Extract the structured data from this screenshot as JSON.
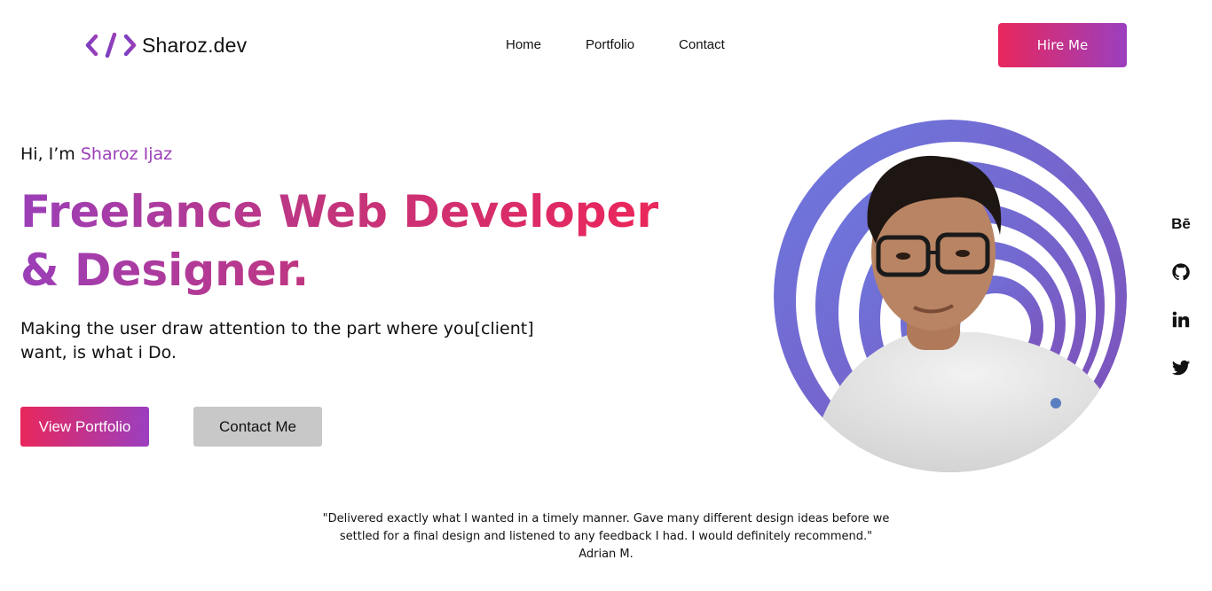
{
  "header": {
    "logo_text": "Sharoz.dev",
    "nav": [
      "Home",
      "Portfolio",
      "Contact"
    ],
    "hire_label": "Hire Me"
  },
  "hero": {
    "greeting_prefix": "Hi, I’m",
    "greeting_name": "Sharoz Ijaz",
    "headline_line1": "Freelance Web Developer",
    "headline_line2": "& Designer.",
    "tagline": "Making the user draw attention to the part where you[client] want, is what i Do.",
    "primary_button": "View Portfolio",
    "secondary_button": "Contact Me",
    "image_alt_icon": "profile-photo"
  },
  "socials": {
    "behance_label": "Bē",
    "icons": [
      "behance-icon",
      "github-icon",
      "linkedin-icon",
      "twitter-icon"
    ]
  },
  "testimonial": {
    "quote": "\"Delivered exactly what I wanted in a timely manner. Gave many different design ideas before we settled for a final design and listened to any feedback I had. I would definitely recommend.\"",
    "author": "Adrian M."
  },
  "colors": {
    "accent_purple": "#9b3fb8",
    "accent_pink": "#e8275c",
    "ring_blue": "#6c7ae0",
    "button_gray": "#c8c8c8"
  }
}
